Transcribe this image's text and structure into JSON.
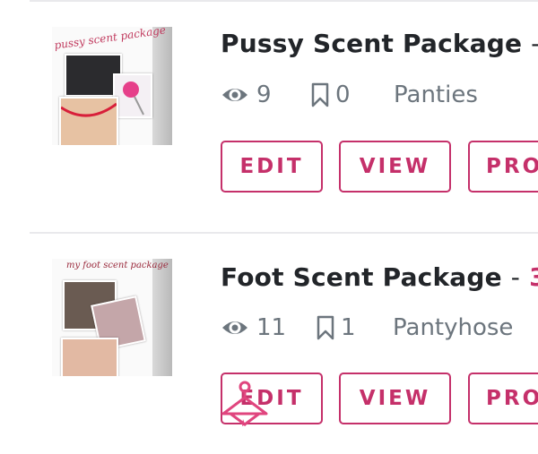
{
  "listings": [
    {
      "thumbnail_caption": "pussy scent package",
      "title": "Pussy Scent Package",
      "separator": "-",
      "price": "",
      "views_icon": "eye-icon",
      "views": "9",
      "bookmarks_icon": "bookmark-icon",
      "bookmarks": "0",
      "category": "Panties",
      "buttons": {
        "edit": "EDIT",
        "view": "VIEW",
        "promo": "PRO"
      }
    },
    {
      "thumbnail_caption": "my foot scent package",
      "title": "Foot Scent Package",
      "separator": "-",
      "price": "3",
      "views_icon": "eye-icon",
      "views": "11",
      "bookmarks_icon": "bookmark-icon",
      "bookmarks": "1",
      "category": "Pantyhose",
      "buttons": {
        "edit": "EDIT",
        "view": "VIEW",
        "promo": "PRO"
      }
    }
  ],
  "colors": {
    "accent": "#c5306a",
    "title_text": "#222529",
    "meta_text": "#6c757d",
    "divider": "#e9e9ec"
  }
}
